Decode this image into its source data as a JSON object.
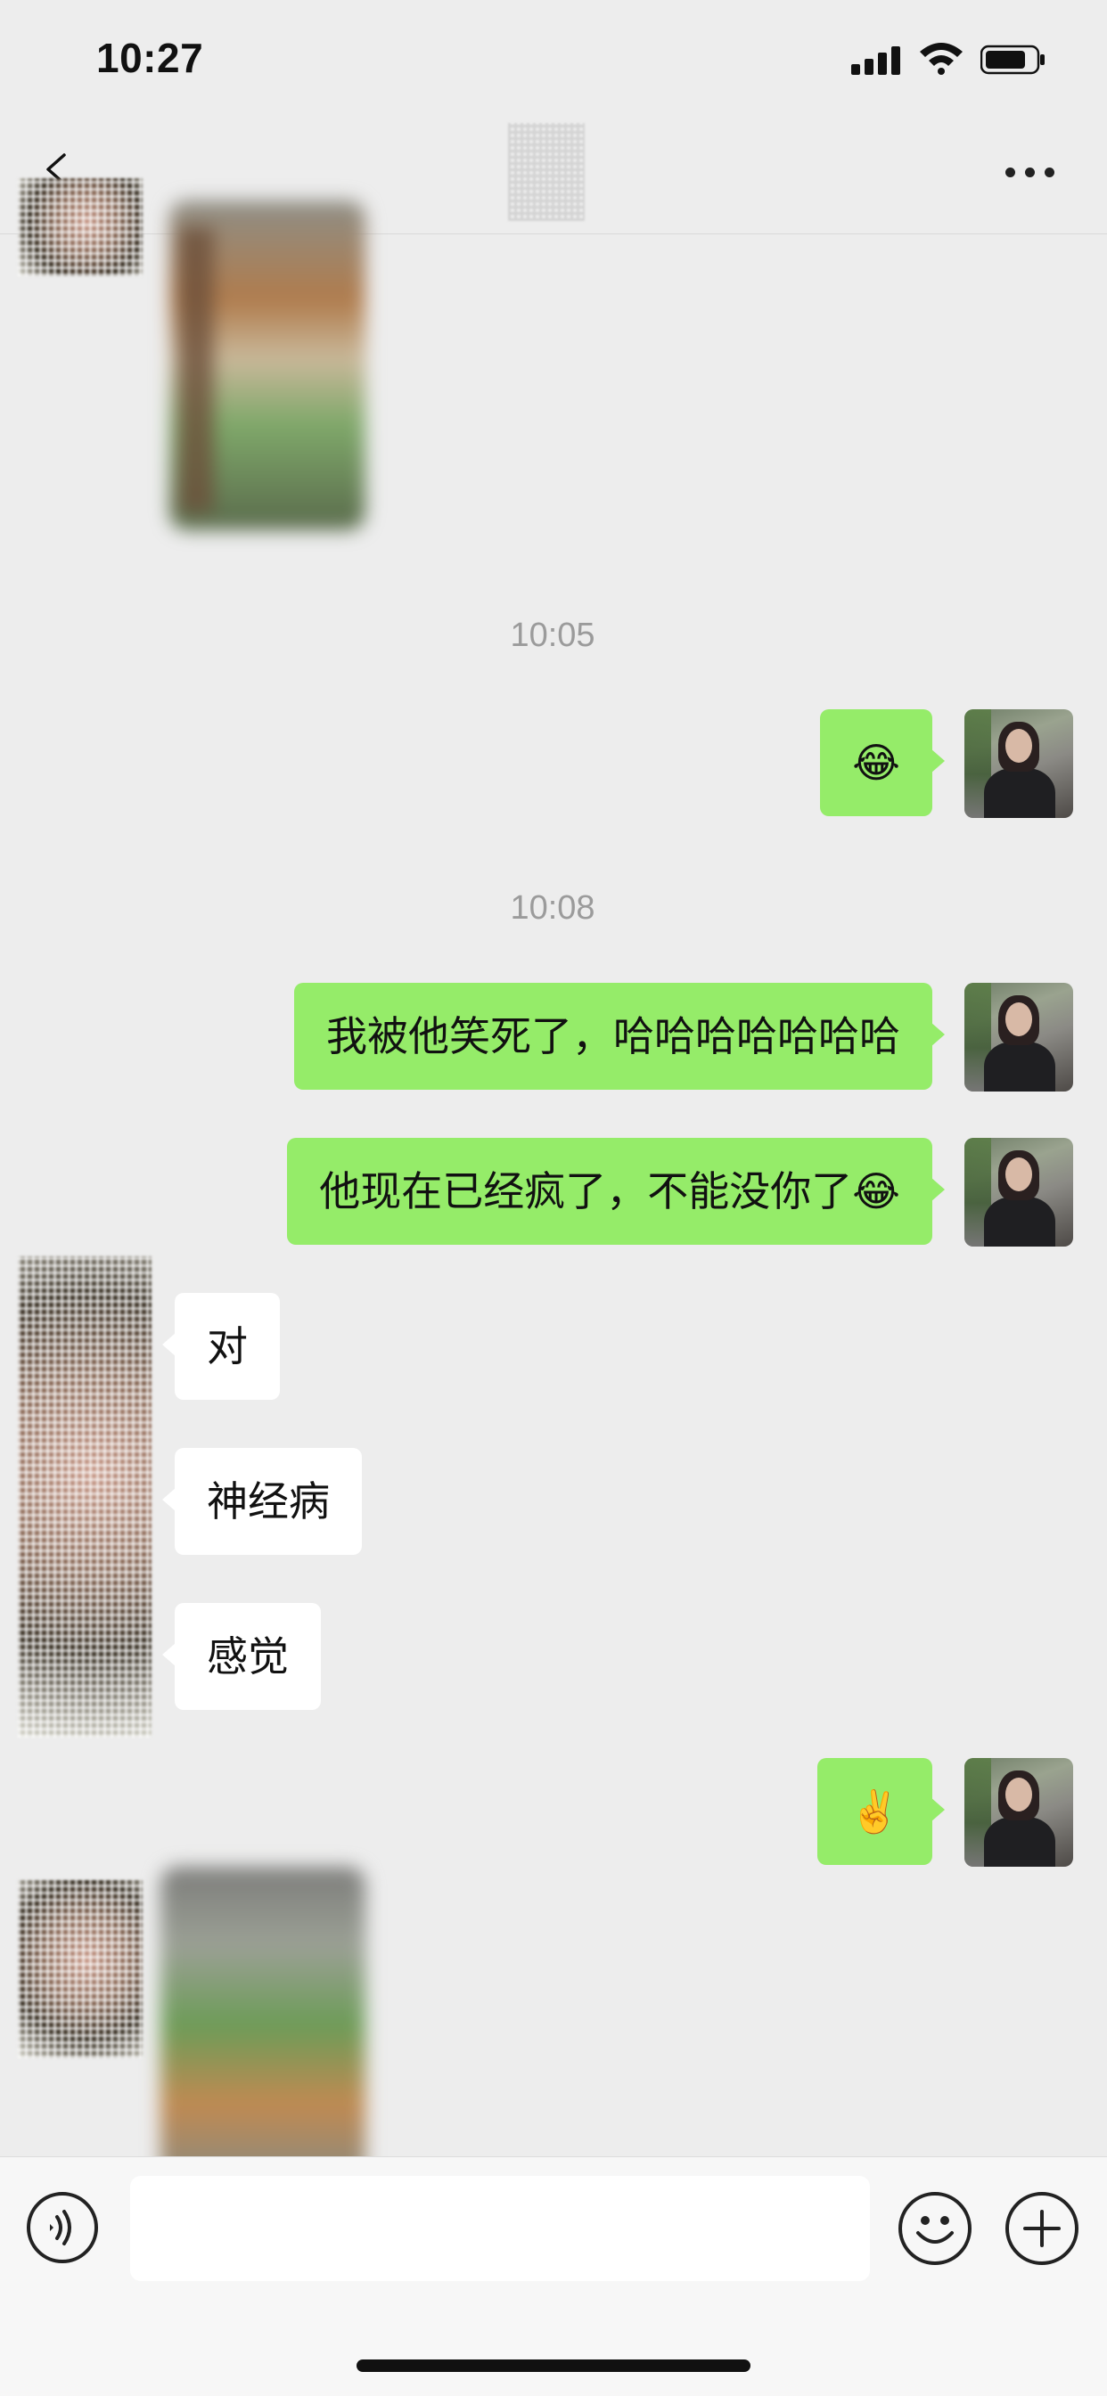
{
  "status_bar": {
    "time": "10:27"
  },
  "header": {
    "back_icon": "chevron-left-icon",
    "more_icon": "more-dots-icon"
  },
  "messages": [
    {
      "type": "image",
      "side": "left",
      "note": "blurred"
    },
    {
      "type": "time",
      "text": "10:05"
    },
    {
      "type": "text",
      "side": "right",
      "text": "😂"
    },
    {
      "type": "time",
      "text": "10:08"
    },
    {
      "type": "text",
      "side": "right",
      "text": "我被他笑死了，哈哈哈哈哈哈哈"
    },
    {
      "type": "text",
      "side": "right",
      "text": "他现在已经疯了，不能没你了😂"
    },
    {
      "type": "text",
      "side": "left",
      "text": "对"
    },
    {
      "type": "text",
      "side": "left",
      "text": "神经病"
    },
    {
      "type": "text",
      "side": "left",
      "text": "感觉"
    },
    {
      "type": "text",
      "side": "right",
      "text": "✌️"
    },
    {
      "type": "image",
      "side": "left",
      "note": "blurred"
    }
  ],
  "composer": {
    "voice_icon": "voice-icon",
    "input_value": "",
    "emoji_icon": "emoji-icon",
    "plus_icon": "plus-icon"
  },
  "colors": {
    "background": "#ededed",
    "my_bubble": "#95ec69",
    "their_bubble": "#ffffff"
  }
}
